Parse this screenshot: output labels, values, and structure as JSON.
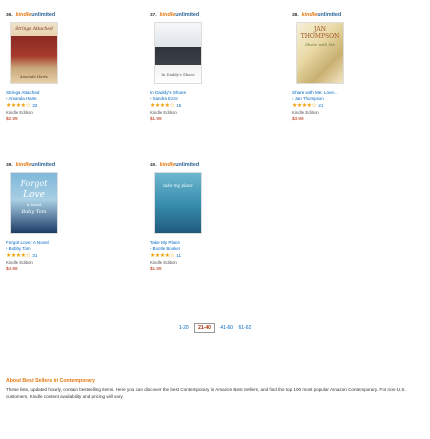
{
  "brand": {
    "kindle": "kindle",
    "unlimited": "unlimited"
  },
  "items": [
    {
      "rank": "36.",
      "cover_lines": [
        "Strings Attached",
        "Amanda Harte"
      ],
      "title": "Strings Attached",
      "author": "› Amanda Harte",
      "stars": "★★★★☆",
      "reviews": "32",
      "format": "Kindle Edition",
      "price": "$2.99"
    },
    {
      "rank": "37.",
      "cover_lines": [
        "In Daddy's Shoes"
      ],
      "title": "In Daddy's Shoes",
      "author": "› Sandra Ezze",
      "stars": "★★★★☆",
      "reviews": "15",
      "format": "Kindle Edition",
      "price": "$1.99"
    },
    {
      "rank": "38.",
      "cover_lines": [
        "JAN",
        "THOMPSON",
        "Share with Me"
      ],
      "title": "Share with Me: Love...",
      "author": "› Jan Thompson",
      "stars": "★★★★☆",
      "reviews": "21",
      "format": "Kindle Edition",
      "price": "$3.99"
    },
    {
      "rank": "39.",
      "cover_lines": [
        "Forgot",
        "Love",
        "A Novel",
        "Baby Tom"
      ],
      "title": "Forgot Love: A Novel",
      "author": "› Bobby Tom",
      "stars": "★★★★☆",
      "reviews": "31",
      "format": "Kindle Edition",
      "price": "$4.99"
    },
    {
      "rank": "40.",
      "cover_lines": [
        "take my place"
      ],
      "title": "Take My Place",
      "author": "› Bootle Booker",
      "stars": "★★★★☆",
      "reviews": "11",
      "format": "Kindle Edition",
      "price": "$1.99"
    }
  ],
  "pagination": {
    "p1": "1-20",
    "current": "21-40",
    "p3": "41-60",
    "p4": "61-62"
  },
  "about": {
    "heading": "About Best Sellers in Contemporary",
    "text": "These lists, updated hourly, contain bestselling items. Here you can discover the best Contemporary in Amazon Best Sellers, and find the top 100 most popular Amazon Contemporary. For non-U.S. customers, Kindle content availability and pricing will vary."
  },
  "colors": {
    "link": "#0066c0",
    "price": "#b12704",
    "accent": "#e47911",
    "star": "#f0a000"
  }
}
